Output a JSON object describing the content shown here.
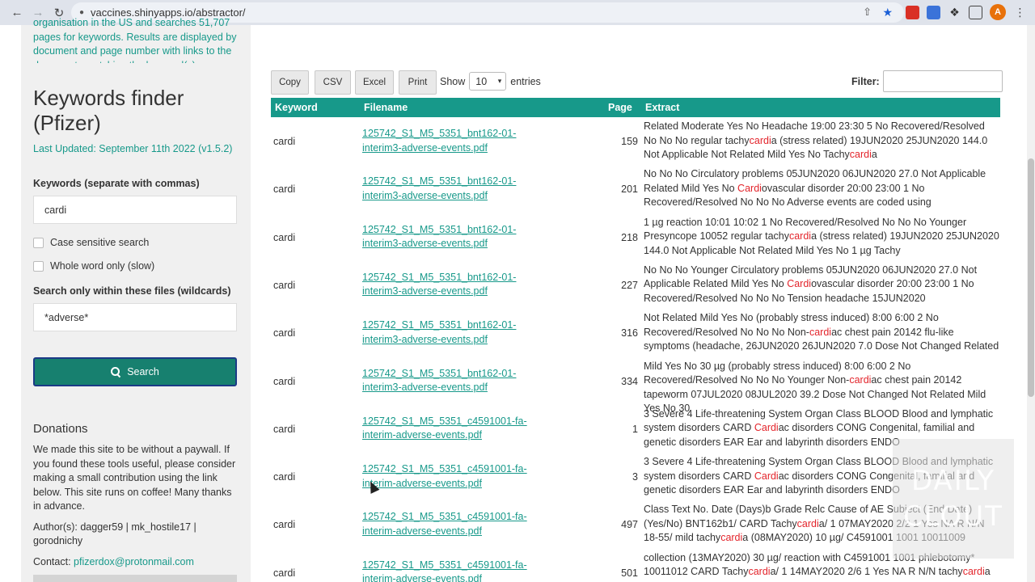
{
  "browser": {
    "url": "vaccines.shinyapps.io/abstractor/",
    "avatar_letter": "A",
    "nav_icons": [
      "back-icon",
      "forward-icon",
      "reload-icon"
    ]
  },
  "sidebar": {
    "intro": "organisation in the US and searches 51,707 pages for keywords. Results are displayed by document and page number with links to the documents matching the keyword(s)",
    "title": "Keywords finder (Pfizer)",
    "last_updated": "Last Updated: September 11th 2022 (v1.5.2)",
    "keywords_label": "Keywords (separate with commas)",
    "keywords_value": "cardi",
    "case_sensitive_label": "Case sensitive search",
    "whole_word_label": "Whole word only (slow)",
    "files_label": "Search only within these files (wildcards)",
    "files_value": "*adverse*",
    "search_button": "Search",
    "donations_title": "Donations",
    "donations_text": "We made this site to be without a paywall. If you found these tools useful, please consider making a small contribution using the link below. This site runs on coffee! Many thanks in advance.",
    "authors": "Author(s): dagger59 | mk_hostile17 | gorodnichy",
    "contact_label": "Contact:",
    "contact_email": "pfizerdox@protonmail.com"
  },
  "toolbar": {
    "copy": "Copy",
    "csv": "CSV",
    "excel": "Excel",
    "print": "Print",
    "show_label": "Show",
    "entries_value": "10",
    "entries_label": "entries",
    "filter_label": "Filter:"
  },
  "table": {
    "columns": [
      "Keyword",
      "Filename",
      "Page",
      "Extract"
    ],
    "rows": [
      {
        "keyword": "cardi",
        "file1": "125742_S1_M5_5351_bnt162-01-",
        "file2": "interim3-adverse-events.pdf",
        "page": "159",
        "extract": [
          "Related Moderate Yes No Headache 19:00 23:30 5 No Recovered/Resolved No No No regular tachy",
          "cardi",
          "a (stress related) 19JUN2020 25JUN2020 144.0 Not Applicable Not Related Mild Yes No Tachy",
          "cardi",
          "a"
        ]
      },
      {
        "keyword": "cardi",
        "file1": "125742_S1_M5_5351_bnt162-01-",
        "file2": "interim3-adverse-events.pdf",
        "page": "201",
        "extract": [
          "No No No Circulatory problems 05JUN2020 06JUN2020 27.0 Not Applicable Related Mild Yes No ",
          "Cardi",
          "ovascular disorder 20:00 23:00 1 No Recovered/Resolved No No No Adverse events are coded using",
          "",
          ""
        ]
      },
      {
        "keyword": "cardi",
        "file1": "125742_S1_M5_5351_bnt162-01-",
        "file2": "interim3-adverse-events.pdf",
        "page": "218",
        "extract": [
          "1 µg reaction 10:01 10:02 1 No Recovered/Resolved No No No Younger Presyncope 10052 regular tachy",
          "cardi",
          "a (stress related) 19JUN2020 25JUN2020 144.0 Not Applicable Not Related Mild Yes No 1 µg Tachy",
          "",
          ""
        ]
      },
      {
        "keyword": "cardi",
        "file1": "125742_S1_M5_5351_bnt162-01-",
        "file2": "interim3-adverse-events.pdf",
        "page": "227",
        "extract": [
          "No No No Younger Circulatory problems 05JUN2020 06JUN2020 27.0 Not Applicable Related Mild Yes No ",
          "Cardi",
          "ovascular disorder 20:00 23:00 1 No Recovered/Resolved No No No Tension headache 15JUN2020",
          "",
          ""
        ]
      },
      {
        "keyword": "cardi",
        "file1": "125742_S1_M5_5351_bnt162-01-",
        "file2": "interim3-adverse-events.pdf",
        "page": "316",
        "extract": [
          "Not Related Mild Yes No (probably stress induced) 8:00 6:00 2 No Recovered/Resolved No No No Non-",
          "cardi",
          "ac chest pain 20142 flu-like symptoms (headache, 26JUN2020 26JUN2020 7.0 Dose Not Changed Related",
          "",
          ""
        ]
      },
      {
        "keyword": "cardi",
        "file1": "125742_S1_M5_5351_bnt162-01-",
        "file2": "interim3-adverse-events.pdf",
        "page": "334",
        "extract": [
          "Mild Yes No 30 µg (probably stress induced) 8:00 6:00 2 No Recovered/Resolved No No No Younger Non-",
          "cardi",
          "ac chest pain 20142 tapeworm 07JUL2020 08JUL2020 39.2 Dose Not Changed Not Related Mild Yes No 30",
          "",
          ""
        ]
      },
      {
        "keyword": "cardi",
        "file1": "125742_S1_M5_5351_c4591001-fa-",
        "file2": "interim-adverse-events.pdf",
        "page": "1",
        "extract": [
          "3 Severe 4 Life-threatening System Organ Class BLOOD Blood and lymphatic system disorders CARD ",
          "Cardi",
          "ac disorders CONG Congenital, familial and genetic disorders EAR Ear and labyrinth disorders ENDO",
          "",
          ""
        ]
      },
      {
        "keyword": "cardi",
        "file1": "125742_S1_M5_5351_c4591001-fa-",
        "file2": "interim-adverse-events.pdf",
        "page": "3",
        "extract": [
          "3 Severe 4 Life-threatening System Organ Class BLOOD Blood and lymphatic system disorders CARD ",
          "Cardi",
          "ac disorders CONG Congenital, familial and genetic disorders EAR Ear and labyrinth disorders ENDO",
          "",
          ""
        ]
      },
      {
        "keyword": "cardi",
        "file1": "125742_S1_M5_5351_c4591001-fa-",
        "file2": "interim-adverse-events.pdf",
        "page": "497",
        "extract": [
          "Class Text No. Date (Days)b Grade Relc Cause of AE Subject (End Date) (Yes/No) BNT162b1/ CARD Tachy",
          "cardi",
          "a/ 1 07MAY2020 2/2 1 Yes NA R N/N 18-55/ mild tachy",
          "cardi",
          "a (08MAY2020) 10 µg/ C4591001 1001 10011009"
        ]
      },
      {
        "keyword": "cardi",
        "file1": "125742_S1_M5_5351_c4591001-fa-",
        "file2": "interim-adverse-events.pdf",
        "page": "501",
        "extract": [
          "collection (13MAY2020) 30 µg/ reaction with C4591001 1001 phlebotomy* 10011012 CARD Tachy",
          "cardi",
          "a/ 1 14MAY2020 2/6 1 Yes NA R N/N tachy",
          "cardi",
          "a"
        ]
      }
    ]
  },
  "watermark": {
    "line1": "DAILY",
    "line2": "CLOUT"
  },
  "colors": {
    "accent": "#17998a",
    "button": "#17806f",
    "highlight": "#e3242b",
    "sidebar_bg": "#f0f0f0"
  }
}
